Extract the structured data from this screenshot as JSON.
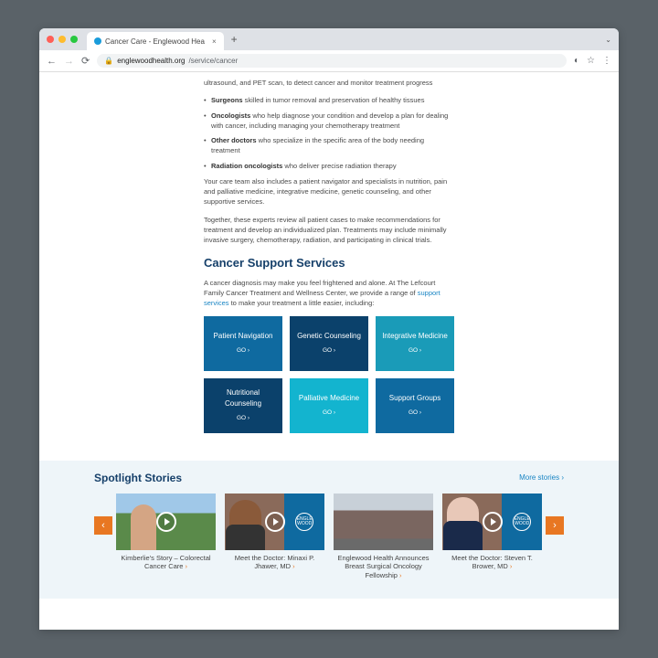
{
  "tab": {
    "title": "Cancer Care - Englewood Hea"
  },
  "url": {
    "host": "englewoodhealth.org",
    "path": "/service/cancer"
  },
  "article": {
    "snippet": "ultrasound, and PET scan, to detect cancer and monitor treatment progress",
    "bullets": [
      {
        "b": "Surgeons",
        "t": " skilled in tumor removal and preservation of healthy tissues"
      },
      {
        "b": "Oncologists",
        "t": " who help diagnose your condition and develop a plan for dealing with cancer, including managing your chemotherapy treatment"
      },
      {
        "b": "Other doctors",
        "t": " who specialize in the specific area of the body needing treatment"
      },
      {
        "b": "Radiation oncologists",
        "t": " who deliver precise radiation therapy"
      }
    ],
    "p1": "Your care team also includes a patient navigator and specialists in nutrition, pain and palliative medicine, integrative medicine, genetic counseling, and other supportive services.",
    "p2": "Together, these experts review all patient cases to make recommendations for treatment and develop an individualized plan. Treatments may include minimally invasive surgery, chemotherapy, radiation, and participating in clinical trials."
  },
  "support": {
    "heading": "Cancer Support Services",
    "intro1": "A cancer diagnosis may make you feel frightened and alone. At The Lefcourt Family Cancer Treatment and Wellness Center, we provide a range of ",
    "link": "support services",
    "intro2": " to make your treatment a little easier, including:",
    "go": "GO ›",
    "tiles": [
      "Patient Navigation",
      "Genetic Counseling",
      "Integrative Medicine",
      "Nutritional Counseling",
      "Palliative Medicine",
      "Support Groups"
    ]
  },
  "spotlight": {
    "heading": "Spotlight Stories",
    "more": "More stories ›",
    "cards": [
      "Kimberlie's Story – Colorectal Cancer Care",
      "Meet the Doctor: Minaxi P. Jhawer, MD",
      "Englewood Health Announces Breast Surgical Oncology Fellowship",
      "Meet the Doctor: Steven T. Brower, MD"
    ]
  }
}
